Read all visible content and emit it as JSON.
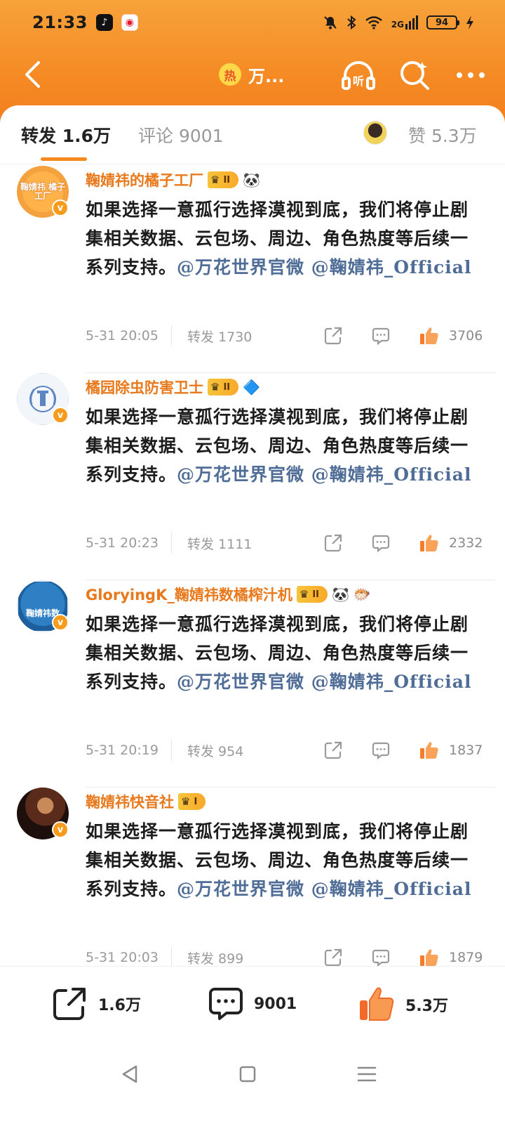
{
  "status_bar": {
    "time": "21:33",
    "battery": "94",
    "network": "2G",
    "icons": [
      "tiktok-icon",
      "weibo-icon",
      "mute-icon",
      "bluetooth-icon",
      "wifi-icon",
      "signal-icon",
      "charging-icon"
    ]
  },
  "nav": {
    "hot_badge": "热",
    "title": "万...",
    "listen_label": "听"
  },
  "tabs": {
    "repost": "转发 1.6万",
    "comment": "评论 9001",
    "likes": "赞 5.3万"
  },
  "posts": [
    {
      "username": "鞠婧祎的橘子工厂",
      "vip_level": "II",
      "extra_badges": [
        "🐼"
      ],
      "avatar_text": "鞠婧祎 橘子工厂",
      "text": "如果选择一意孤行选择漠视到底，我们将停止剧集相关数据、云包场、周边、角色热度等后续一系列支持。",
      "mention1": "@万花世界官微",
      "mention2": "@鞠婧祎_Official",
      "date": "5-31 20:05",
      "reposts": "转发 1730",
      "likes": "3706"
    },
    {
      "username": "橘园除虫防害卫士",
      "vip_level": "II",
      "extra_badges": [
        "🔷"
      ],
      "avatar_text": "",
      "text": "如果选择一意孤行选择漠视到底，我们将停止剧集相关数据、云包场、周边、角色热度等后续一系列支持。",
      "mention1": "@万花世界官微",
      "mention2": "@鞠婧祎_Official",
      "date": "5-31 20:23",
      "reposts": "转发 1111",
      "likes": "2332"
    },
    {
      "username": "GloryingK_鞠婧祎数橘榨汁机",
      "vip_level": "II",
      "extra_badges": [
        "🐼",
        "🐡"
      ],
      "avatar_text": "鞠婧祎数",
      "text": "如果选择一意孤行选择漠视到底，我们将停止剧集相关数据、云包场、周边、角色热度等后续一系列支持。",
      "mention1": "@万花世界官微",
      "mention2": "@鞠婧祎_Official",
      "date": "5-31 20:19",
      "reposts": "转发 954",
      "likes": "1837"
    },
    {
      "username": "鞠婧祎快音社",
      "vip_level": "I",
      "extra_badges": [],
      "avatar_text": "",
      "text": "如果选择一意孤行选择漠视到底，我们将停止剧集相关数据、云包场、周边、角色热度等后续一系列支持。",
      "mention1": "@万花世界官微",
      "mention2": "@鞠婧祎_Official",
      "date": "5-31 20:03",
      "reposts": "转发 899",
      "likes": "1879"
    }
  ],
  "bottom_bar": {
    "repost_count": "1.6万",
    "comment_count": "9001",
    "like_count": "5.3万"
  },
  "colors": {
    "header_orange": "#f58a24",
    "username_orange": "#e8791c",
    "mention_blue": "#4f6d96",
    "like_orange": "#f57c2a"
  }
}
